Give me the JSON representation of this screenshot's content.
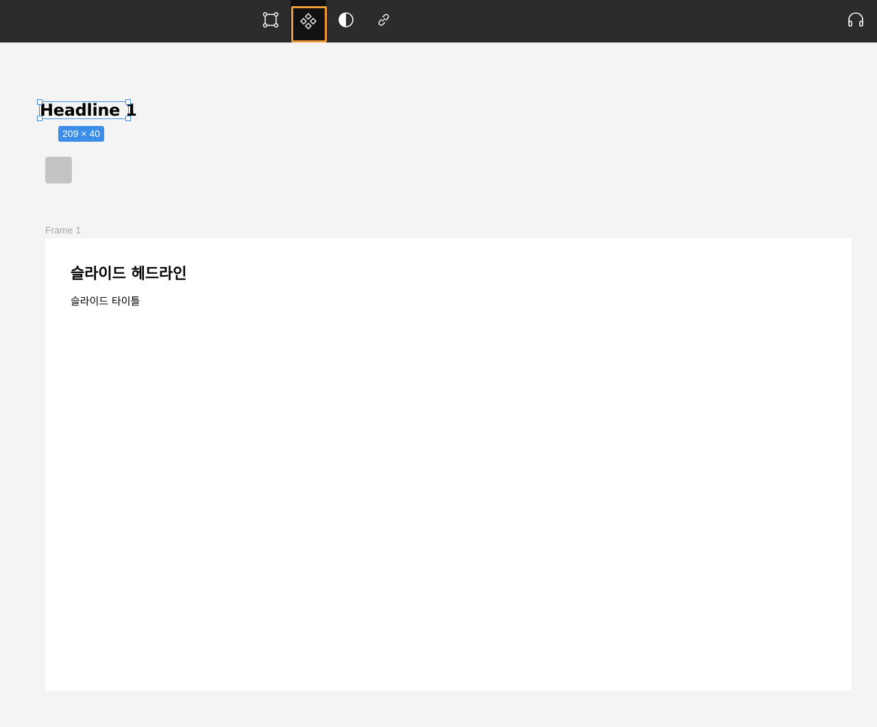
{
  "toolbar": {
    "tools": [
      {
        "icon": "frame-icon",
        "active": false
      },
      {
        "icon": "components-icon",
        "active": true
      },
      {
        "icon": "contrast-icon",
        "active": false
      },
      {
        "icon": "link-icon",
        "active": false
      }
    ],
    "right_icon": "headphones-icon",
    "active_highlight_color": "#f19a38",
    "background_color": "#2c2c2c"
  },
  "canvas": {
    "selected_text": "Headline 1",
    "selection_size": "209 × 40",
    "selection_color": "#3b8ee8",
    "frame": {
      "label": "Frame 1",
      "headline": "슬라이드 헤드라인",
      "title": "슬라이드 타이틀"
    }
  }
}
